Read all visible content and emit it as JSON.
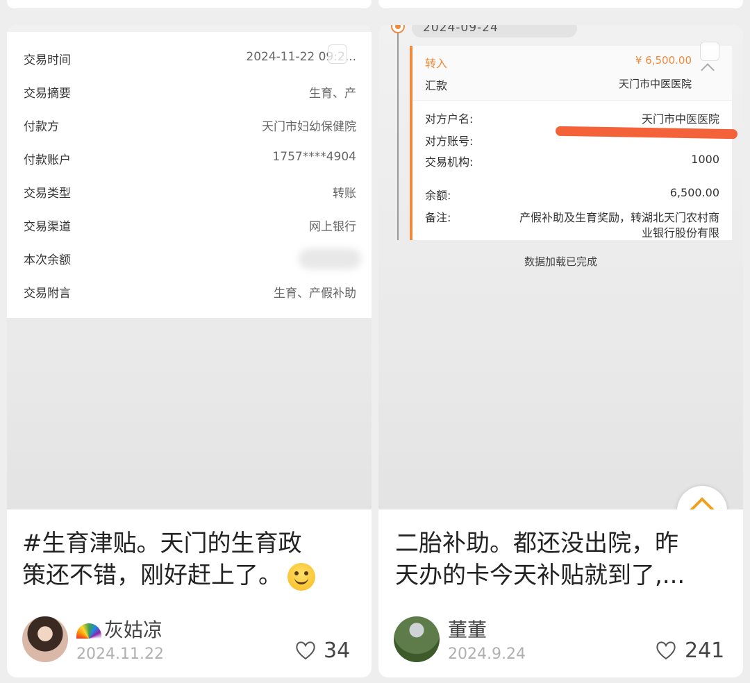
{
  "left_post": {
    "details": [
      {
        "label": "交易时间",
        "value": "2024-11-22 09:2..."
      },
      {
        "label": "交易摘要",
        "value": "生育、产"
      },
      {
        "label": "付款方",
        "value": "天门市妇幼保健院"
      },
      {
        "label": "付款账户",
        "value": "1757****4904"
      },
      {
        "label": "交易类型",
        "value": "转账"
      },
      {
        "label": "交易渠道",
        "value": "网上银行"
      },
      {
        "label": "本次余额",
        "value": ""
      },
      {
        "label": "交易附言",
        "value": "生育、产假补助"
      }
    ],
    "text_line1": "#生育津贴。天门的生育政",
    "text_line2": "策还不错，刚好赶上了。",
    "emoji": "smiling-face",
    "user": "灰姑凉",
    "date": "2024.11.22",
    "likes": "34"
  },
  "right_post": {
    "timeline_date": "2024-09-24",
    "txn": {
      "type": "转入",
      "amount": "¥ 6,500.00",
      "desc": "汇款",
      "payer_short": "天门市中医医院",
      "counterparty_label": "对方户名:",
      "counterparty_value": "天门市中医医院",
      "account_label": "对方账号:",
      "institution_label": "交易机构:",
      "institution_value": "1000",
      "balance_label": "余额:",
      "balance_value": "6,500.00",
      "remark_label": "备注:",
      "remark_line1": "产假补助及生育奖励，转湖北天门农村商",
      "remark_line2": "业银行股份有限"
    },
    "loaded_text": "数据加载已完成",
    "text_line1": "二胎补助。都还没出院，昨",
    "text_line2": "天办的卡今天补贴就到了,...",
    "user": "董董",
    "date": "2024.9.24",
    "likes": "241"
  },
  "colors": {
    "accent": "#f08a3c",
    "scribble": "#f4623a"
  }
}
